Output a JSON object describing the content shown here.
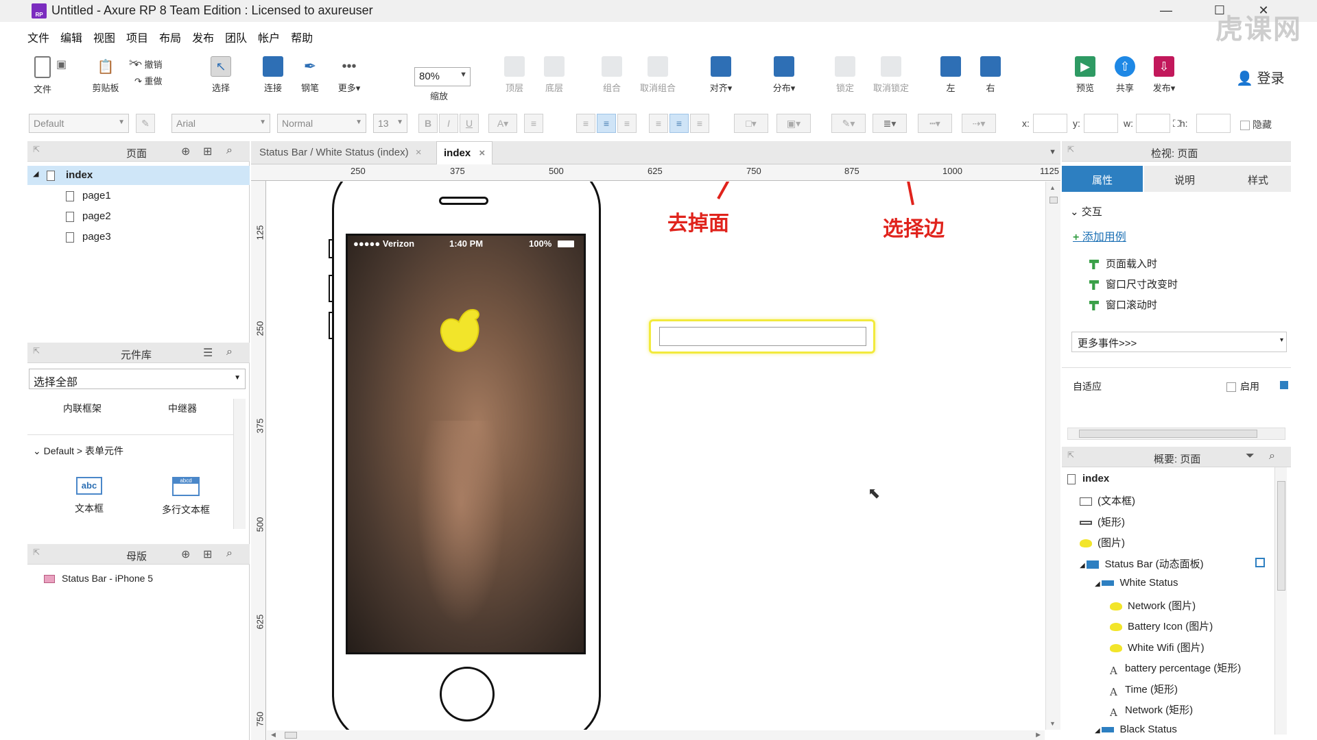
{
  "window": {
    "title": "Untitled - Axure RP 8 Team Edition : Licensed to axureuser",
    "app_icon": "RP",
    "watermark": "虎课网"
  },
  "menu": [
    "文件",
    "编辑",
    "视图",
    "项目",
    "布局",
    "发布",
    "团队",
    "帐户",
    "帮助"
  ],
  "toolbar": {
    "file": "文件",
    "clipboard": "剪贴板",
    "undo": "撤销",
    "redo": "重做",
    "select": "选择",
    "connect": "连接",
    "pen": "钢笔",
    "more": "更多▾",
    "zoom_value": "80%",
    "zoom_label": "缩放",
    "top_layer": "顶层",
    "bottom_layer": "底层",
    "group": "组合",
    "ungroup": "取消组合",
    "align": "对齐▾",
    "distribute": "分布▾",
    "lock": "锁定",
    "unlock": "取消锁定",
    "left": "左",
    "right": "右",
    "preview": "预览",
    "share": "共享",
    "publish": "发布▾",
    "login": "登录"
  },
  "format": {
    "style": "Default",
    "font": "Arial",
    "weight": "Normal",
    "size": "13",
    "x_label": "x:",
    "y_label": "y:",
    "w_label": "w:",
    "h_label": "h:",
    "hide_label": "隐藏"
  },
  "pages_panel": {
    "title": "页面",
    "root": "index",
    "children": [
      "page1",
      "page2",
      "page3"
    ]
  },
  "library_panel": {
    "title": "元件库",
    "select_all": "选择全部",
    "top_items": [
      "内联框架",
      "中继器"
    ],
    "group_label": "Default > 表单元件",
    "items": [
      {
        "label": "文本框",
        "icon_text": "abc"
      },
      {
        "label": "多行文本框",
        "icon_text": "abcd"
      }
    ]
  },
  "masters_panel": {
    "title": "母版",
    "items": [
      "Status Bar - iPhone 5"
    ]
  },
  "canvas": {
    "tabs": [
      {
        "label": "Status Bar / White Status (index)",
        "close": "×"
      },
      {
        "label": "index",
        "close": "×"
      }
    ],
    "ruler_h": [
      "250",
      "375",
      "500",
      "625",
      "750",
      "875",
      "1000",
      "1125"
    ],
    "ruler_v": [
      "125",
      "250",
      "375",
      "500",
      "625",
      "750"
    ],
    "phone_status": {
      "carrier": "●●●●● Verizon",
      "time": "1:40 PM",
      "battery": "100%"
    },
    "annotations": [
      "去掉面",
      "选择边"
    ]
  },
  "inspector": {
    "title": "检视: 页面",
    "tabs": [
      "属性",
      "说明",
      "样式"
    ],
    "section": "交互",
    "add_case": "添加用例",
    "events": [
      "页面载入时",
      "窗口尺寸改变时",
      "窗口滚动时"
    ],
    "more_events": "更多事件>>>",
    "adaptive": "自适应",
    "enable": "启用"
  },
  "outline": {
    "title": "概要: 页面",
    "root": "index",
    "rows": [
      {
        "label": "(文本框)",
        "indent": 1,
        "icon": "textbox-icon"
      },
      {
        "label": "(矩形)",
        "indent": 1,
        "icon": "rectangle-icon"
      },
      {
        "label": "(图片)",
        "indent": 1,
        "icon": "image-icon"
      },
      {
        "label": "Status Bar (动态面板)",
        "indent": 1,
        "icon": "dynamic-panel-icon"
      },
      {
        "label": "White Status",
        "indent": 2,
        "icon": "state-icon"
      },
      {
        "label": "Network (图片)",
        "indent": 3,
        "icon": "image-icon"
      },
      {
        "label": "Battery Icon (图片)",
        "indent": 3,
        "icon": "image-icon"
      },
      {
        "label": "White Wifi (图片)",
        "indent": 3,
        "icon": "image-icon"
      },
      {
        "label": "battery percentage (矩形)",
        "indent": 3,
        "icon": "text-icon"
      },
      {
        "label": "Time (矩形)",
        "indent": 3,
        "icon": "text-icon"
      },
      {
        "label": "Network (矩形)",
        "indent": 3,
        "icon": "text-icon"
      },
      {
        "label": "Black Status",
        "indent": 2,
        "icon": "state-icon"
      }
    ]
  },
  "colors": {
    "accent": "#2d7fc1",
    "annotation": "#e0231c",
    "selection": "#f2ea3c",
    "page_selected": "#cfe6f8"
  }
}
